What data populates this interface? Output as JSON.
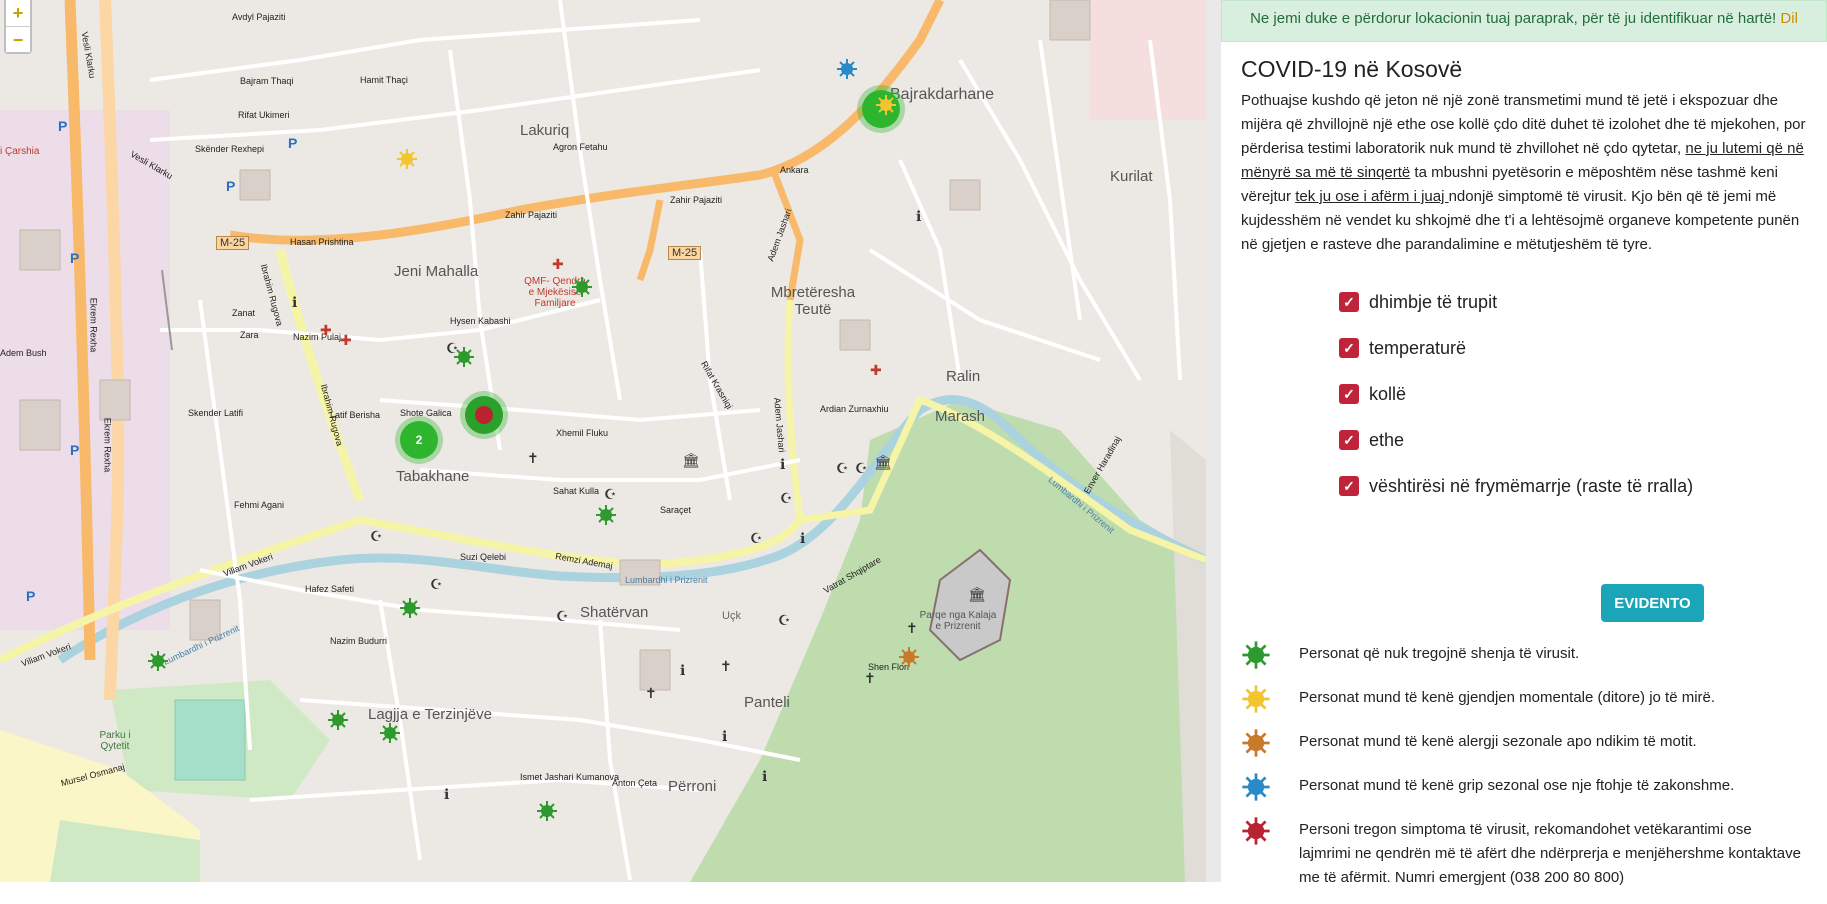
{
  "map": {
    "zoom_in": "+",
    "zoom_out": "−",
    "cluster_count": "2",
    "labels": {
      "avdyl": "Avdyl Pajaziti",
      "bajram": "Bajram Thaqi",
      "hamit_thaqi": "Hamit Thaçi",
      "rifat_ukimeri": "Rifat Ukimeri",
      "skender_rexhepi": "Skënder Rexhepi",
      "lakuriq": "Lakuriq",
      "agron_fetahu": "Agron Fetahu",
      "hasan_prishtina": "Hasan Prishtina",
      "zahir_pajaziti_1": "Zahir Pajaziti",
      "zahir_pajaziti_2": "Zahir Pajaziti",
      "ankara": "Ankara",
      "m25_a": "M-25",
      "m25_b": "M-25",
      "jeni_mahalla": "Jeni Mahalla",
      "qmf": "QMF- Qendra e Mjekësisë Familjare",
      "mbreteresha": "Mbretëresha Teutë",
      "ibrahim_rugova_1": "Ibrahim Rugova",
      "ibrahim_rugova_2": "Ibrahim Rugova",
      "nazim_pulaj": "Nazim Pulaj",
      "zanat": "Zanat",
      "zara": "Zara",
      "adem_bush": "Adem Bush",
      "skender_latifi": "Skender Latifi",
      "ekrem_rexha_1": "Ekrem Rexha",
      "ekrem_rexha_2": "Ekrem Rexha",
      "vesli_klarku_1": "Vesli Klarku",
      "vesli_klarku_2": "Vesli Klarku",
      "tabakhane": "Tabakhane",
      "fehmi_agani": "Fehmi Agani",
      "viliam_vokeri_1": "Viliam Vokeri",
      "viliam_vokeri_2": "Viliam Vokeri",
      "remzi_ademaj": "Remzi Ademaj",
      "lumbardhi_1": "Lumbardhi i Prizrenit",
      "lumbardhi_2": "Lumbardhi i Prizrenit",
      "lumbardhi_3": "Lumbardhi i Prizrenit",
      "shatervan": "Shatërvan",
      "ucka": "Uçk",
      "panteli": "Panteli",
      "perroni": "Përroni",
      "lagjja": "Lagjja e Terzinjëve",
      "parku": "Parku i Qytetit",
      "mursel": "Mursel Osmanaj",
      "ismet": "Ismet Jashari Kumanova",
      "anton_ceta": "Anton Çeta",
      "marash": "Marash",
      "ralin": "Ralin",
      "kurilat": "Kurilat",
      "bajrakdarhane": "Bajrakdarhane",
      "enver_hadri": "Enver Haradinaj",
      "kalaja": "Parqe nga Kalaja e Prizrenit",
      "adem_jashari_1": "Adem Jashari",
      "adem_jashari_2": "Adem Jashari",
      "vatrat": "Vatrat Shqiptare",
      "shen_flori": "Shen Flori",
      "qarshia": "i Çarshia",
      "hysen_kabashi": "Hysen Kabashi",
      "latif_berisha": "Latif Berisha",
      "shote_galica": "Shote Galica",
      "suzi_qelebi": "Suzi Qelebi",
      "hafez_safeti": "Hafez Safeti",
      "nazim_budurri": "Nazim Budurri",
      "ardian_zurnaxhiu": "Ardian Zurnaxhiu",
      "xhemil_fluku": "Xhemil Fluku",
      "sahat_kulla": "Sahat Kulla",
      "saracet": "Saraçet",
      "rifat_krasniqi": "Rifat Krasniqi",
      "dil": "Dil"
    }
  },
  "alert": {
    "text": "Ne jemi duke e përdorur lokacionin tuaj paraprak, për të ju identifikuar në hartë!",
    "link": "Dil"
  },
  "title": "COVID-19 në Kosovë",
  "intro": {
    "p1": "Pothuajse kushdo që jeton në një zonë transmetimi mund të jetë i ekspozuar dhe mijëra që zhvillojnë një ethe ose kollë çdo ditë duhet të izolohet dhe të mjekohen, por përderisa testimi laboratorik nuk mund të zhvillohet në çdo qytetar, ",
    "u1": "ne ju lutemi që në mënyrë sa më të sinqertë",
    "p2": " ta mbushni pyetësorin e mëposhtëm nëse tashmë keni vërejtur ",
    "u2": "tek ju ose i afërm i juaj ",
    "p3": "ndonjë simptomë të virusit. Kjo bën që të jemi më kujdesshëm në vendet ku shkojmë dhe t'i a lehtësojmë organeve kompetente punën në gjetjen e rasteve dhe parandalimine e mëtutjeshëm të tyre."
  },
  "symptoms": [
    "dhimbje të trupit",
    "temperaturë",
    "kollë",
    "ethe",
    "vështirësi në frymëmarrje (raste të rralla)"
  ],
  "button": "EVIDENTO",
  "legend": [
    {
      "color": "#2e9a2e",
      "text": "Personat që nuk tregojnë shenja të virusit."
    },
    {
      "color": "#f2c531",
      "text": "Personat mund të kenë gjendjen momentale (ditore) jo të mirë."
    },
    {
      "color": "#c87a2a",
      "text": "Personat mund të kenë alergji sezonale apo ndikim të motit."
    },
    {
      "color": "#2a8ac8",
      "text": "Personat mund të kenë grip sezonal ose nje ftohje të zakonshme."
    },
    {
      "color": "#b8232f",
      "text": "Personi tregon simptoma të virusit, rekomandohet vetëkarantimi ose lajmrimi ne qendrën më të afërt dhe ndërprerja e menjëhershme kontaktave me të afërmit. Numri emergjent (038 200 80 800)"
    }
  ]
}
